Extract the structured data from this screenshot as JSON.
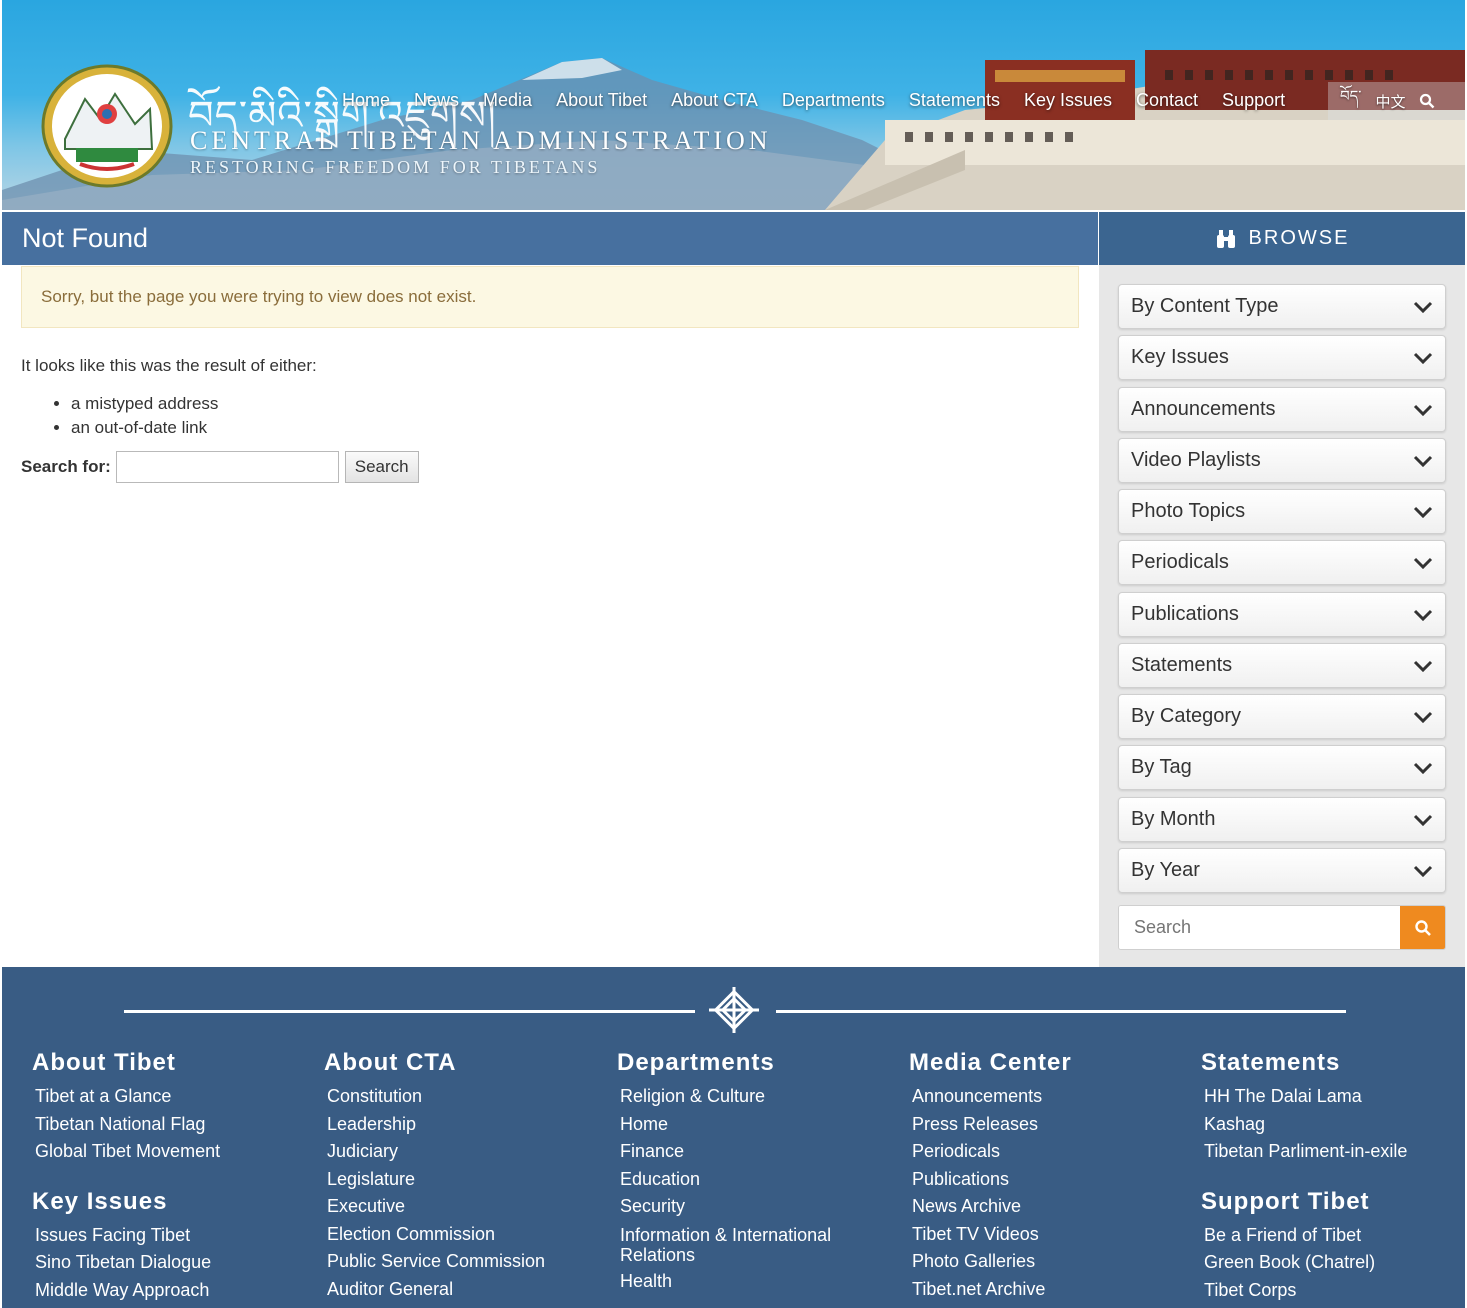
{
  "header": {
    "tibetan_script": "བོད་མིའི་སྒྲིག་འཛུགས།",
    "org_name": "CENTRAL TIBETAN ADMINISTRATION",
    "tagline": "RESTORING FREEDOM FOR TIBETANS",
    "nav": [
      "Home",
      "News",
      "Media",
      "About Tibet",
      "About CTA",
      "Departments",
      "Statements",
      "Key Issues",
      "Contact",
      "Support"
    ],
    "lang_tibetan": "བོད་",
    "lang_chinese": "中文",
    "search_icon": "search-icon"
  },
  "page": {
    "title": "Not Found",
    "notice": "Sorry, but the page you were trying to view does not exist.",
    "intro": "It looks like this was the result of either:",
    "reasons": [
      "a mistyped address",
      "an out-of-date link"
    ],
    "search_label": "Search for:",
    "search_value": "",
    "search_button": "Search"
  },
  "sidebar": {
    "browse_label": "BROWSE",
    "browse_icon": "binoculars-icon",
    "items": [
      "By Content Type",
      "Key Issues",
      "Announcements",
      "Video Playlists",
      "Photo Topics",
      "Periodicals",
      "Publications",
      "Statements",
      "By Category",
      "By Tag",
      "By Month",
      "By Year"
    ],
    "search_placeholder": "Search",
    "accent_color": "#ef8a1f"
  },
  "footer": {
    "columns": [
      {
        "heading": "About Tibet",
        "links": [
          "Tibet at a Glance",
          "Tibetan National Flag",
          "Global Tibet Movement"
        ],
        "heading2": "Key Issues",
        "links2": [
          "Issues Facing Tibet",
          "Sino Tibetan Dialogue",
          "Middle Way Approach"
        ]
      },
      {
        "heading": "About CTA",
        "links": [
          "Constitution",
          "Leadership",
          "Judiciary",
          "Legislature",
          "Executive",
          "Election Commission",
          "Public Service Commission",
          "Auditor General"
        ]
      },
      {
        "heading": "Departments",
        "links": [
          "Religion & Culture",
          "Home",
          "Finance",
          "Education",
          "Security",
          "Information & International Relations",
          "Health"
        ]
      },
      {
        "heading": "Media Center",
        "links": [
          "Announcements",
          "Press Releases",
          "Periodicals",
          "Publications",
          "News Archive",
          "Tibet TV Videos",
          "Photo Galleries",
          "Tibet.net Archive"
        ]
      },
      {
        "heading": "Statements",
        "links": [
          "HH The Dalai Lama",
          "Kashag",
          "Tibetan Parliment-in-exile"
        ],
        "heading2": "Support Tibet",
        "links2": [
          "Be a Friend of Tibet",
          "Green Book (Chatrel)",
          "Tibet Corps"
        ]
      }
    ],
    "background_color": "#395c84"
  }
}
